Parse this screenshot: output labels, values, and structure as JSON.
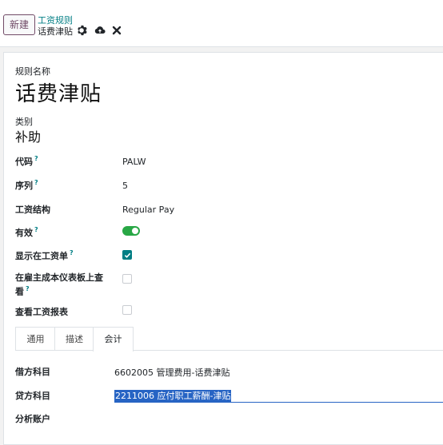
{
  "toolbar": {
    "new_label": "新建",
    "breadcrumb_parent": "工资规则",
    "breadcrumb_current": "话费津贴"
  },
  "form": {
    "name_label": "规则名称",
    "name_value": "话费津贴",
    "category_label": "类别",
    "category_value": "补助",
    "fields": {
      "code_label": "代码",
      "code_value": "PALW",
      "sequence_label": "序列",
      "sequence_value": "5",
      "structure_label": "工资结构",
      "structure_value": "Regular Pay",
      "active_label": "有效",
      "active_value": true,
      "show_payslip_label": "显示在工资单",
      "show_payslip_value": true,
      "employer_cost_label_1": "在雇主成本仪表板上查",
      "employer_cost_label_2": "看",
      "employer_cost_value": false,
      "payroll_report_label": "查看工资报表",
      "payroll_report_value": false,
      "help_mark": "?"
    },
    "tabs": [
      {
        "label": "通用",
        "active": false
      },
      {
        "label": "描述",
        "active": false
      },
      {
        "label": "会计",
        "active": true
      }
    ],
    "accounting": {
      "debit_label": "借方科目",
      "debit_value": "6602005 管理费用-话费津贴",
      "credit_label": "贷方科目",
      "credit_value": "2211006 应付职工薪酬-津贴",
      "analytic_label": "分析账户"
    }
  },
  "colors": {
    "brand": "#714b67",
    "link": "#017e84",
    "toggle_on": "#28a745",
    "selection": "#2764c4"
  }
}
